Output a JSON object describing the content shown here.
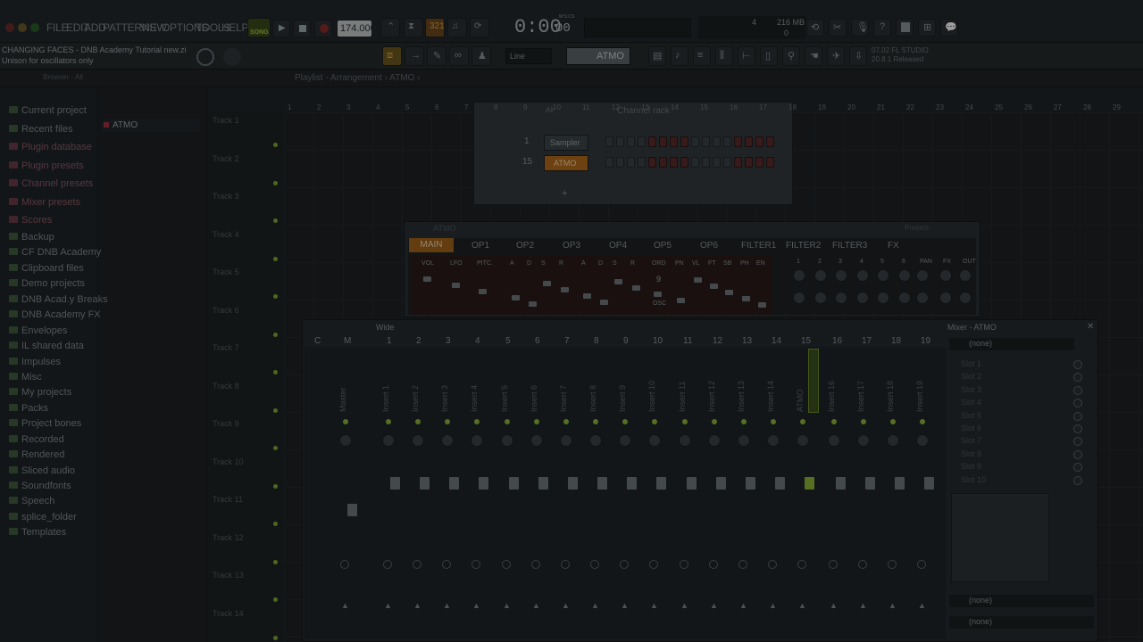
{
  "menu": [
    "FILE",
    "EDIT",
    "ADD",
    "PATTERNS",
    "VIEW",
    "OPTIONS",
    "TOOLS",
    "HELP"
  ],
  "transport": {
    "mode": "SONG",
    "tempo": "174.000",
    "time": "0:00",
    "time_sub": "00",
    "time_label": "M:S:CS",
    "cpu": "216 MB",
    "cpu2": "0",
    "voices": "4"
  },
  "hint": {
    "line1": "CHANGING FACES - DNB Academy Tutorial new.zi",
    "line2": "Unison for oscillators only"
  },
  "snap": "Line",
  "current_pattern": "ATMO",
  "news": {
    "line1": "07.02 FL STUDIO",
    "line2": "20.8.1 Released"
  },
  "breadcrumb": "Playlist - Arrangement › ATMO ›",
  "browser": {
    "header": "Browser - All",
    "items": [
      {
        "label": "Current project",
        "pink": false
      },
      {
        "label": "Recent files",
        "pink": false
      },
      {
        "label": "Plugin database",
        "pink": true
      },
      {
        "label": "Plugin presets",
        "pink": true
      },
      {
        "label": "Channel presets",
        "pink": true
      },
      {
        "label": "Mixer presets",
        "pink": true
      },
      {
        "label": "Scores",
        "pink": true
      },
      {
        "label": "Backup",
        "pink": false
      },
      {
        "label": "CF DNB Academy",
        "pink": false
      },
      {
        "label": "Clipboard files",
        "pink": false
      },
      {
        "label": "Demo projects",
        "pink": false
      },
      {
        "label": "DNB Acad.y Breaks",
        "pink": false
      },
      {
        "label": "DNB Academy FX",
        "pink": false
      },
      {
        "label": "Envelopes",
        "pink": false
      },
      {
        "label": "IL shared data",
        "pink": false
      },
      {
        "label": "Impulses",
        "pink": false
      },
      {
        "label": "Misc",
        "pink": false
      },
      {
        "label": "My projects",
        "pink": false
      },
      {
        "label": "Packs",
        "pink": false
      },
      {
        "label": "Project bones",
        "pink": false
      },
      {
        "label": "Recorded",
        "pink": false
      },
      {
        "label": "Rendered",
        "pink": false
      },
      {
        "label": "Sliced audio",
        "pink": false
      },
      {
        "label": "Soundfonts",
        "pink": false
      },
      {
        "label": "Speech",
        "pink": false
      },
      {
        "label": "splice_folder",
        "pink": false
      },
      {
        "label": "Templates",
        "pink": false
      }
    ]
  },
  "patterns": [
    "ATMO"
  ],
  "tracks": [
    "Track 1",
    "Track 2",
    "Track 3",
    "Track 4",
    "Track 5",
    "Track 6",
    "Track 7",
    "Track 8",
    "Track 9",
    "Track 10",
    "Track 11",
    "Track 12",
    "Track 13",
    "Track 14"
  ],
  "ruler": [
    "1",
    "2",
    "3",
    "4",
    "5",
    "6",
    "7",
    "8",
    "9",
    "10",
    "11",
    "12",
    "13",
    "14",
    "15",
    "16",
    "17",
    "18",
    "19",
    "20",
    "21",
    "22",
    "23",
    "24",
    "25",
    "26",
    "27",
    "28",
    "29"
  ],
  "channel_rack": {
    "title": "Channel rack",
    "filter": "All",
    "channels": [
      {
        "num": "1",
        "name": "Sampler"
      },
      {
        "num": "15",
        "name": "ATMO"
      }
    ]
  },
  "plugin": {
    "title": "ATMO",
    "preset": "Presets",
    "tabs": [
      "MAIN",
      "OP1",
      "OP2",
      "OP3",
      "OP4",
      "OP5",
      "OP6",
      "FILTER1",
      "FILTER2",
      "FILTER3",
      "FX"
    ],
    "params": [
      "VOL",
      "LFO",
      "PITC.",
      "A",
      "D",
      "S",
      "R",
      "A",
      "D",
      "S",
      "R",
      "ORD",
      "PN",
      "VL",
      "FT",
      "SB",
      "PH",
      "EN"
    ],
    "ord": "9",
    "osc": "OSC",
    "matrix": [
      "1",
      "2",
      "3",
      "4",
      "5",
      "6",
      "PAN",
      "FX",
      "OUT"
    ]
  },
  "mixer": {
    "title": "Mixer - ATMO",
    "mode": "Wide",
    "header": [
      "C",
      "M",
      "1",
      "2",
      "3",
      "4",
      "5",
      "6",
      "7",
      "8",
      "9",
      "10",
      "11",
      "12",
      "13",
      "14",
      "15",
      "16",
      "17",
      "18",
      "19"
    ],
    "labels": [
      "Master",
      "Insert 1",
      "Insert 2",
      "Insert 3",
      "Insert 4",
      "Insert 5",
      "Insert 6",
      "Insert 7",
      "Insert 8",
      "Insert 9",
      "Insert 10",
      "Insert 11",
      "Insert 12",
      "Insert 13",
      "Insert 14",
      "ATMO",
      "Insert 16",
      "Insert 17",
      "Insert 18",
      "Insert 19"
    ],
    "input": "(none)",
    "slots": [
      "Slot 1",
      "Slot 2",
      "Slot 3",
      "Slot 4",
      "Slot 5",
      "Slot 6",
      "Slot 7",
      "Slot 8",
      "Slot 9",
      "Slot 10"
    ],
    "output1": "(none)",
    "output2": "(none)"
  }
}
